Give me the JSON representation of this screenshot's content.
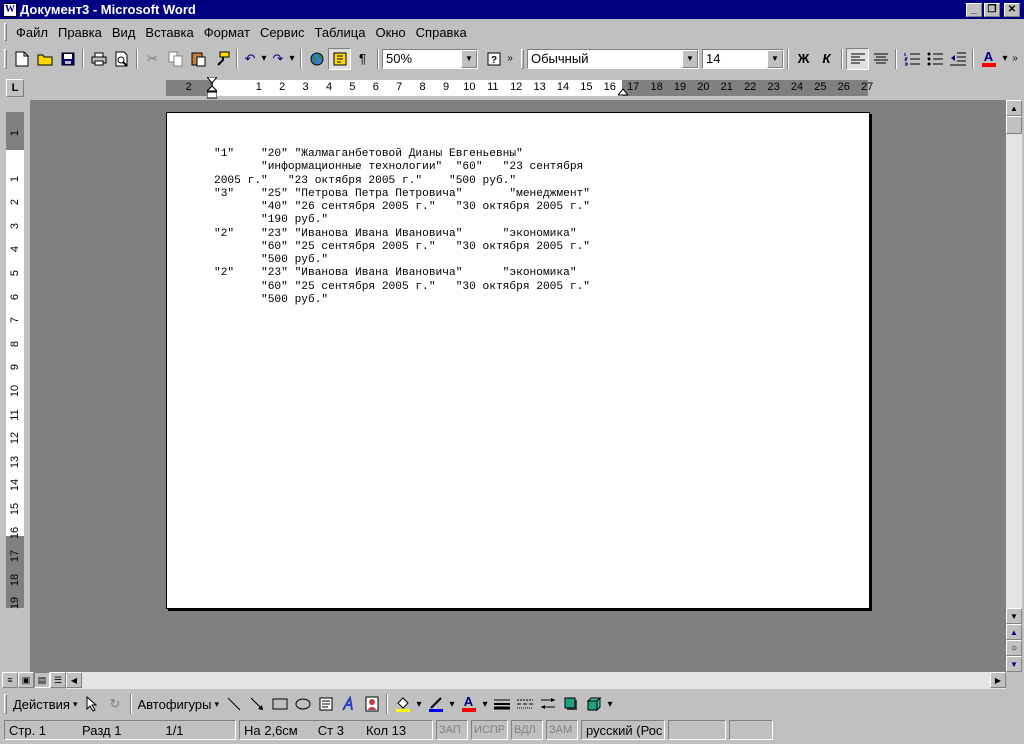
{
  "window": {
    "title": "Документ3 - Microsoft Word",
    "app_icon": "word-doc-icon",
    "min_label": "_",
    "restore_label": "❐",
    "close_label": "✕"
  },
  "menu": {
    "items": [
      "Файл",
      "Правка",
      "Вид",
      "Вставка",
      "Формат",
      "Сервис",
      "Таблица",
      "Окно",
      "Справка"
    ]
  },
  "toolbar": {
    "zoom_value": "50%",
    "style_value": "Обычный",
    "font_size_value": "14",
    "bold_label": "Ж",
    "italic_label": "К",
    "paragraph_mark": "¶",
    "font_color_label": "A",
    "accent_font_color": "#ff0000"
  },
  "ruler": {
    "tab_selector_label": "L",
    "horizontal_numbers": [
      "2",
      "1",
      "1",
      "2",
      "3",
      "4",
      "5",
      "6",
      "7",
      "8",
      "9",
      "10",
      "11",
      "12",
      "13",
      "14",
      "15",
      "16",
      "17",
      "18",
      "19",
      "20",
      "21",
      "22",
      "23",
      "24",
      "25",
      "26",
      "27"
    ],
    "vertical_numbers": [
      "1",
      "1",
      "2",
      "3",
      "4",
      "5",
      "6",
      "7",
      "8",
      "9",
      "10",
      "11",
      "12",
      "13",
      "14",
      "15",
      "16",
      "17",
      "18",
      "19"
    ]
  },
  "document": {
    "lines": [
      "\"1\"    \"20\" \"Жалмаганбетовой Дианы Евгеньевны\"",
      "       \"информационные технологии\"  \"60\"   \"23 сентября",
      "2005 г.\"   \"23 октября 2005 г.\"    \"500 руб.\"",
      "\"3\"    \"25\" \"Петрова Петра Петровича\"       \"менеджмент\"",
      "       \"40\" \"26 сентября 2005 г.\"   \"30 октября 2005 г.\"",
      "       \"190 руб.\"",
      "\"2\"    \"23\" \"Иванова Ивана Ивановича\"      \"экономика\"",
      "       \"60\" \"25 сентября 2005 г.\"   \"30 октября 2005 г.\"",
      "       \"500 руб.\"",
      "\"2\"    \"23\" \"Иванова Ивана Ивановича\"      \"экономика\"",
      "       \"60\" \"25 сентября 2005 г.\"   \"30 октября 2005 г.\"",
      "       \"500 руб.\""
    ]
  },
  "drawbar": {
    "actions_label": "Действия",
    "autoshapes_label": "Автофигуры"
  },
  "status": {
    "page": "Стр. 1",
    "section": "Разд 1",
    "page_of": "1/1",
    "at": "На 2,6см",
    "line": "Ст 3",
    "col": "Кол 13",
    "rec": "ЗАП",
    "trk": "ИСПР",
    "ext": "ВДЛ",
    "ovr": "ЗАМ",
    "language": "русский (Рос"
  }
}
